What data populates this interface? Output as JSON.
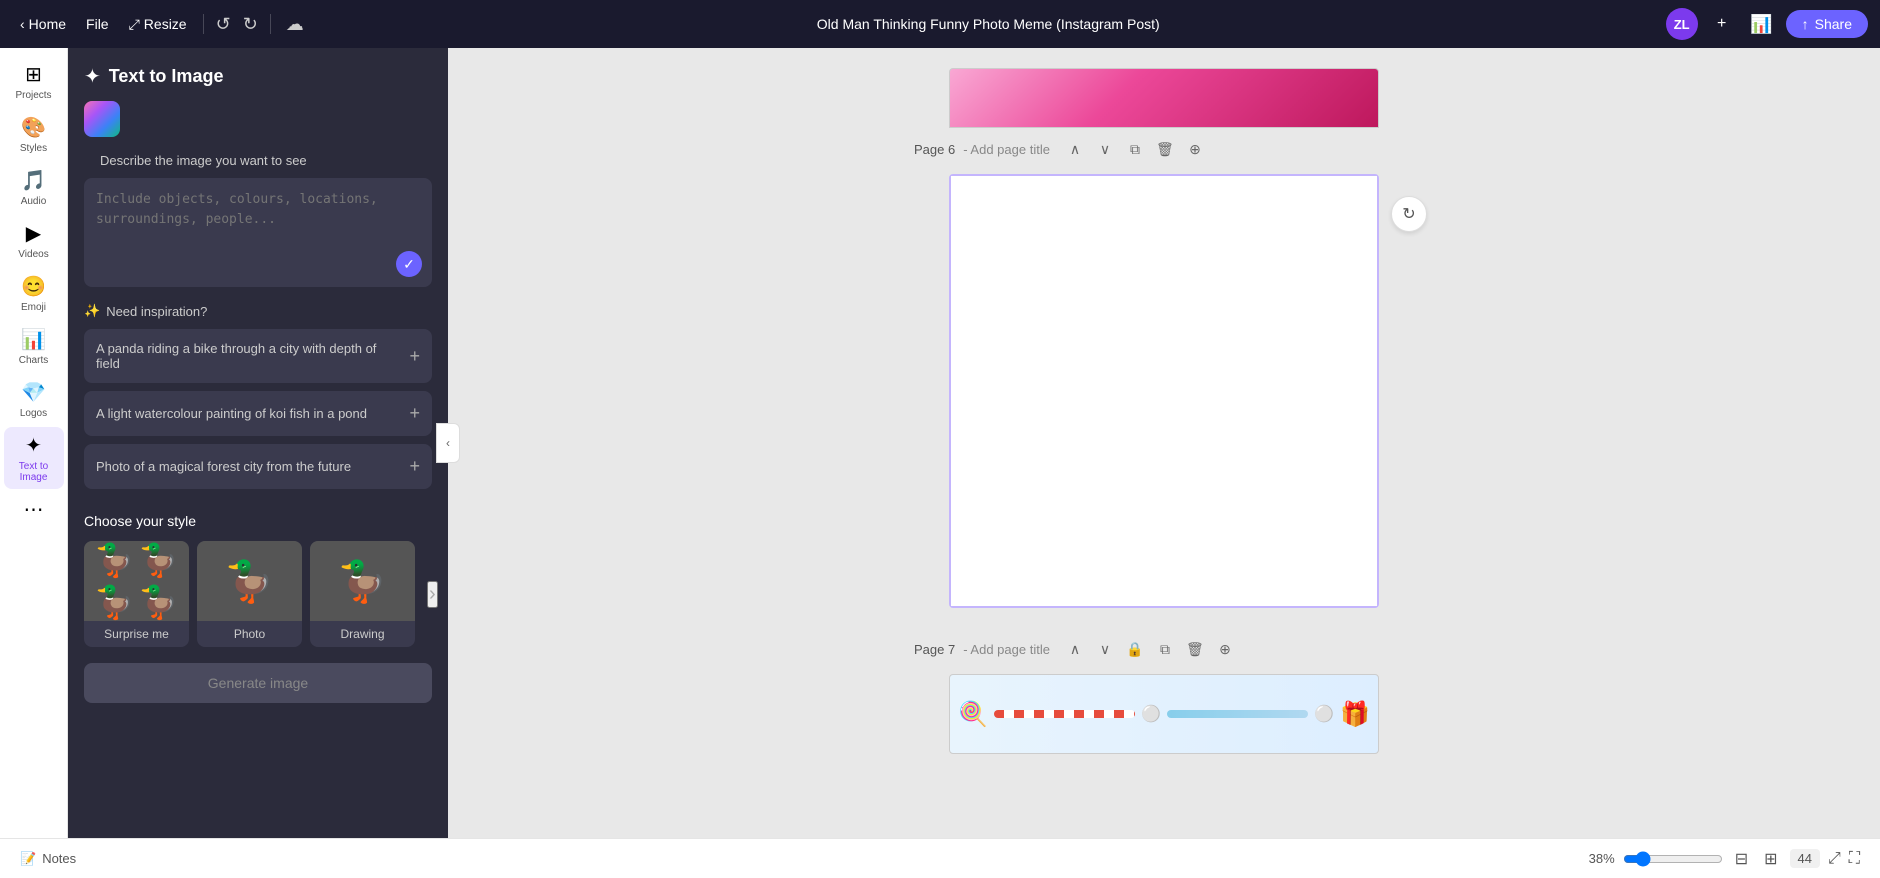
{
  "topbar": {
    "home_label": "Home",
    "file_label": "File",
    "resize_label": "Resize",
    "doc_title": "Old Man Thinking Funny Photo Meme (Instagram Post)",
    "avatar_initials": "ZL",
    "share_label": "Share"
  },
  "sidebar": {
    "items": [
      {
        "id": "projects",
        "label": "Projects",
        "icon": "⊞"
      },
      {
        "id": "styles",
        "label": "Styles",
        "icon": "🎨"
      },
      {
        "id": "audio",
        "label": "Audio",
        "icon": "🎵"
      },
      {
        "id": "videos",
        "label": "Videos",
        "icon": "▶"
      },
      {
        "id": "emoji",
        "label": "Emoji",
        "icon": "😊"
      },
      {
        "id": "charts",
        "label": "Charts",
        "icon": "📊"
      },
      {
        "id": "logos",
        "label": "Logos",
        "icon": "💎"
      },
      {
        "id": "text-to-image",
        "label": "Text to Image",
        "icon": "✦"
      }
    ]
  },
  "panel": {
    "title": "Text to Image",
    "icon": "✦",
    "describe_label": "Describe the image you want to see",
    "textarea_placeholder": "Include objects, colours, locations, surroundings, people...",
    "textarea_value": "",
    "inspiration_label": "Need inspiration?",
    "inspiration_items": [
      {
        "text": "A panda riding a bike through a city with depth of field"
      },
      {
        "text": "A light watercolour painting of koi fish in a pond"
      },
      {
        "text": "Photo of a magical forest city from the future"
      }
    ],
    "style_label": "Choose your style",
    "style_items": [
      {
        "label": "Surprise me",
        "icon": "🦆"
      },
      {
        "label": "Photo",
        "icon": "🦆"
      },
      {
        "label": "Drawing",
        "icon": "🦆"
      }
    ],
    "generate_label": "Generate image"
  },
  "canvas": {
    "page6_label": "Page 6",
    "page6_add_title": "- Add page title",
    "page7_label": "Page 7",
    "page7_add_title": "- Add page title"
  },
  "bottombar": {
    "notes_label": "Notes",
    "zoom_percent": "38%",
    "page_count": "44"
  }
}
